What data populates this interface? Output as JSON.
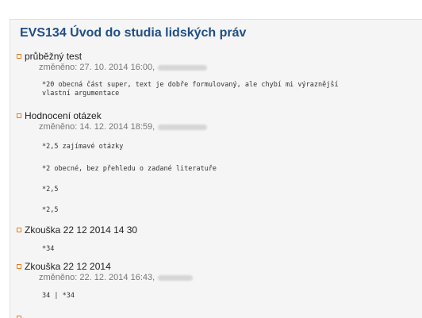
{
  "course": {
    "title": "EVS134 Úvod do studia lidských práv"
  },
  "entries": [
    {
      "title": "průběžný test",
      "modified": "změněno: 27. 10. 2014 16:00,",
      "notes": [
        "*20 obecná část super, text je dobře formulovaný, ale chybí mi výraznější\nvlastní argumentace"
      ]
    },
    {
      "title": "Hodnocení otázek",
      "modified": "změněno: 14. 12. 2014 18:59,",
      "notes": [
        "*2,5 zajímavé otázky",
        "*2 obecné, bez přehledu o zadané literatuře",
        "*2,5",
        "*2,5"
      ]
    },
    {
      "title": "Zkouška 22 12 2014 14 30",
      "notes": [
        "*34"
      ]
    },
    {
      "title": "Zkouška 22 12 2014",
      "modified": "změněno: 22. 12. 2014 16:43,",
      "notes": [
        "34 | *34"
      ]
    }
  ],
  "colors": {
    "title": "#1f4f86",
    "bullet": "#e07a1f",
    "panel": "#f5f5f5"
  }
}
